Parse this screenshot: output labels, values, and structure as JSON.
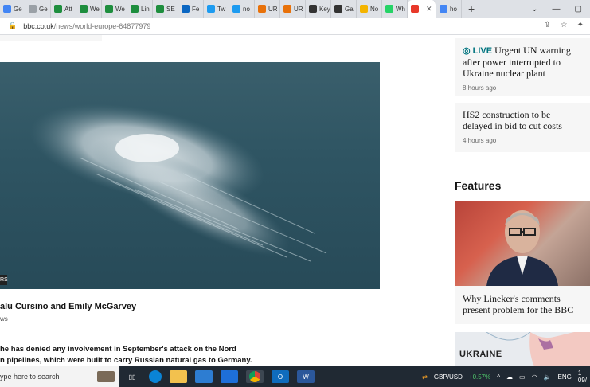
{
  "browser": {
    "tabs": [
      {
        "label": "Ge",
        "color": "#4285f4"
      },
      {
        "label": "Ge",
        "color": "#9aa0a6"
      },
      {
        "label": "Att",
        "color": "#1e8e3e"
      },
      {
        "label": "We",
        "color": "#1e8e3e"
      },
      {
        "label": "We",
        "color": "#1e8e3e"
      },
      {
        "label": "Lin",
        "color": "#1e8e3e"
      },
      {
        "label": "SE",
        "color": "#1e8e3e"
      },
      {
        "label": "Fe",
        "color": "#0a66c2"
      },
      {
        "label": "Tw",
        "color": "#1d9bf0"
      },
      {
        "label": "no",
        "color": "#1d9bf0"
      },
      {
        "label": "UR",
        "color": "#e8710a"
      },
      {
        "label": "UR",
        "color": "#e8710a"
      },
      {
        "label": "Key",
        "color": "#333333"
      },
      {
        "label": "Ga",
        "color": "#333333"
      },
      {
        "label": "No",
        "color": "#f4b400"
      },
      {
        "label": "Wh",
        "color": "#25d366"
      },
      {
        "label": "",
        "color": "#e8392a",
        "active": true
      },
      {
        "label": "ho",
        "color": "#4285f4"
      }
    ],
    "new_tab": "+",
    "window_controls": {
      "chevron": "⌄",
      "minimize": "—",
      "maximize": "▢"
    },
    "url_host": "bbc.co.uk",
    "url_path": "/news/world-europe-64877979"
  },
  "article": {
    "caption_tag": "RS",
    "byline": "alu Cursino and Emily McGarvey",
    "byline_sub": "ws",
    "paragraph_line1": "he has denied any involvement in September's attack on the Nord",
    "paragraph_line2": "n pipelines, which were built to carry Russian natural gas to Germany."
  },
  "sidebar": {
    "live_label": "LIVE",
    "card1_title": "Urgent UN warning after power interrupted to Ukraine nuclear plant",
    "card1_time": "8 hours ago",
    "card2_title": "HS2 construction to be delayed in bid to cut costs",
    "card2_time": "4 hours ago",
    "features_heading": "Features",
    "feature_title": "Why Lineker's comments present problem for the BBC",
    "map_label": "UKRAINE"
  },
  "taskbar": {
    "search_placeholder": "ype here to search",
    "ticker": "GBP/USD",
    "ticker_change": "+0.57%",
    "lang": "ENG",
    "time_partial": "1",
    "date_partial": "09/"
  }
}
